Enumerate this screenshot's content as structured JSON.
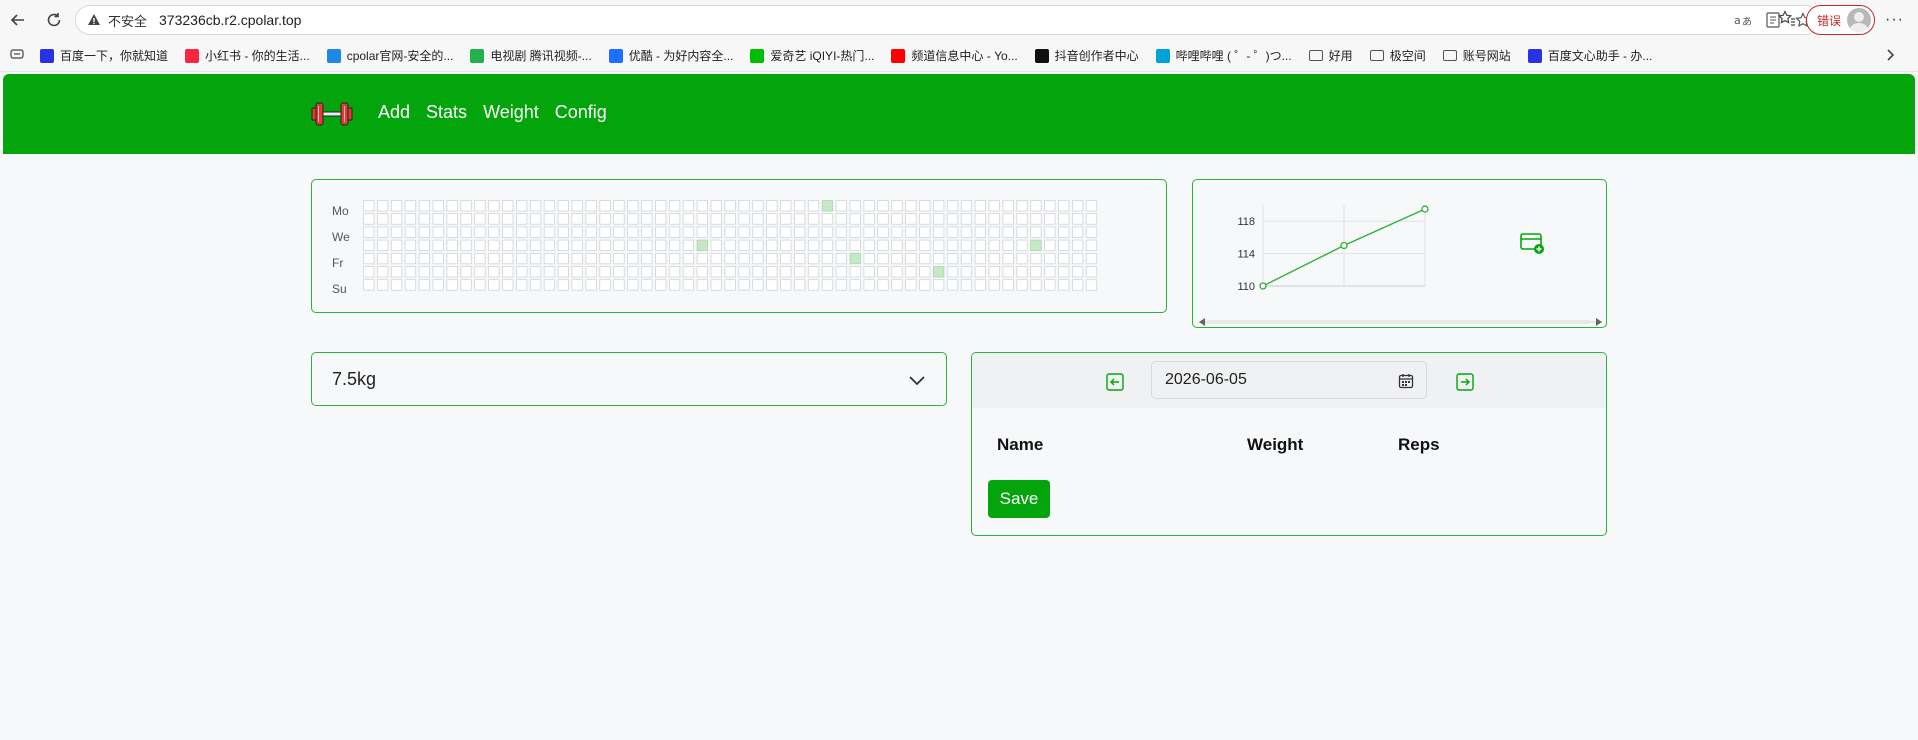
{
  "browser": {
    "insecure_label": "不安全",
    "url": "373236cb.r2.cpolar.top",
    "error_label": "错误"
  },
  "bookmarks": [
    {
      "label": "百度一下，你就知道",
      "color": "#2932e1"
    },
    {
      "label": "小红书 - 你的生活...",
      "color": "#ff2442"
    },
    {
      "label": "cpolar官网-安全的...",
      "color": "#1e88e5"
    },
    {
      "label": "电视剧 腾讯视频-...",
      "color": "#22b14c"
    },
    {
      "label": "优酷 - 为好内容全...",
      "color": "#1e6fff"
    },
    {
      "label": "爱奇艺 iQIYI-热门...",
      "color": "#00be06"
    },
    {
      "label": "频道信息中心 - Yo...",
      "color": "#ff0000"
    },
    {
      "label": "抖音创作者中心",
      "color": "#111111"
    },
    {
      "label": "哔哩哔哩 ( ゜- ゜)つ...",
      "color": "#00a1d6"
    },
    {
      "label": "好用",
      "color": "folder"
    },
    {
      "label": "极空间",
      "color": "folder"
    },
    {
      "label": "账号网站",
      "color": "folder"
    },
    {
      "label": "百度文心助手 - 办...",
      "color": "#2932e1"
    }
  ],
  "nav": {
    "add": "Add",
    "stats": "Stats",
    "weight": "Weight",
    "config": "Config"
  },
  "heatmap": {
    "day_labels": [
      "Mo",
      "We",
      "Fr",
      "Su"
    ],
    "weeks": 53,
    "days": 7,
    "active_cells": [
      [
        33,
        0
      ],
      [
        24,
        3
      ],
      [
        48,
        3
      ],
      [
        35,
        4
      ],
      [
        41,
        5
      ]
    ],
    "empty_color": "#ffffff",
    "active_color": "#c6e8c6"
  },
  "chart_data": {
    "type": "line",
    "x": [
      1,
      2,
      3
    ],
    "values": [
      110,
      115,
      119.5
    ],
    "yticks": [
      110,
      114,
      118
    ],
    "ylim": [
      110,
      120
    ],
    "grid": true,
    "color": "#2fb136"
  },
  "exercise_select": {
    "value": "7.5kg"
  },
  "workout": {
    "date": "2026-06-05",
    "col_name": "Name",
    "col_weight": "Weight",
    "col_reps": "Reps",
    "save_label": "Save"
  },
  "colors": {
    "brand": "#04a50c",
    "border": "#2fb136"
  }
}
